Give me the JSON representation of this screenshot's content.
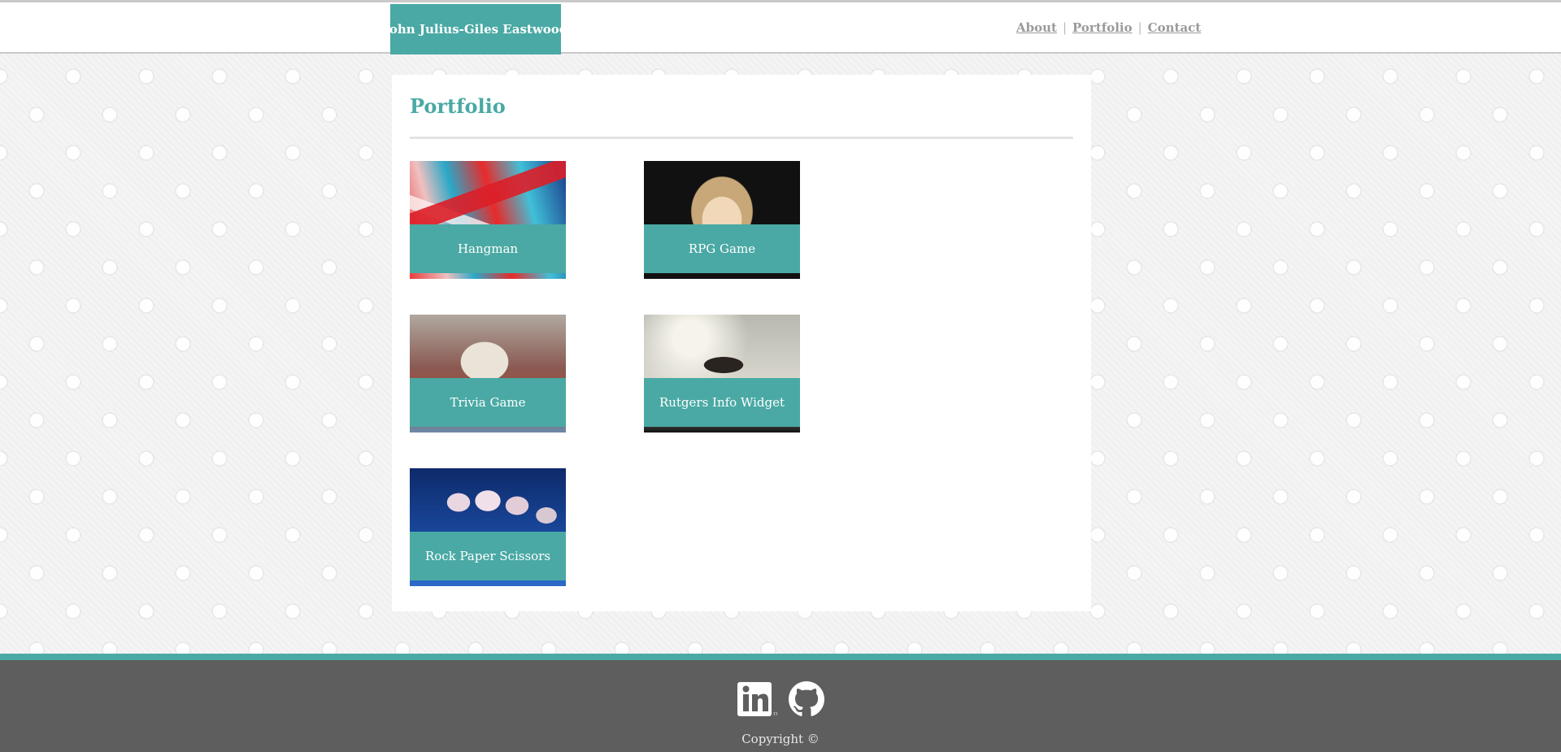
{
  "header": {
    "brand": "John Julius-Giles Eastwood",
    "nav": [
      {
        "label": "About"
      },
      {
        "label": "Portfolio"
      },
      {
        "label": "Contact"
      }
    ],
    "separator": "|"
  },
  "main": {
    "title": "Portfolio",
    "projects": [
      {
        "label": "Hangman",
        "image": "abstract-paint-image"
      },
      {
        "label": "RPG Game",
        "image": "curly-haired-child-image"
      },
      {
        "label": "Trivia Game",
        "image": "siamese-cat-image"
      },
      {
        "label": "Rutgers Info Widget",
        "image": "jumping-silhouette-image"
      },
      {
        "label": "Rock Paper Scissors",
        "image": "orchid-image"
      }
    ]
  },
  "footer": {
    "social": [
      {
        "icon": "linkedin-icon",
        "color": "#ffffff"
      },
      {
        "icon": "github-icon",
        "color": "#ffffff"
      }
    ],
    "copyright": "Copyright ©"
  },
  "colors": {
    "accent": "#4aa9a4",
    "footer_bg": "#5e5e5e",
    "nav_text": "#9a9a9a"
  }
}
